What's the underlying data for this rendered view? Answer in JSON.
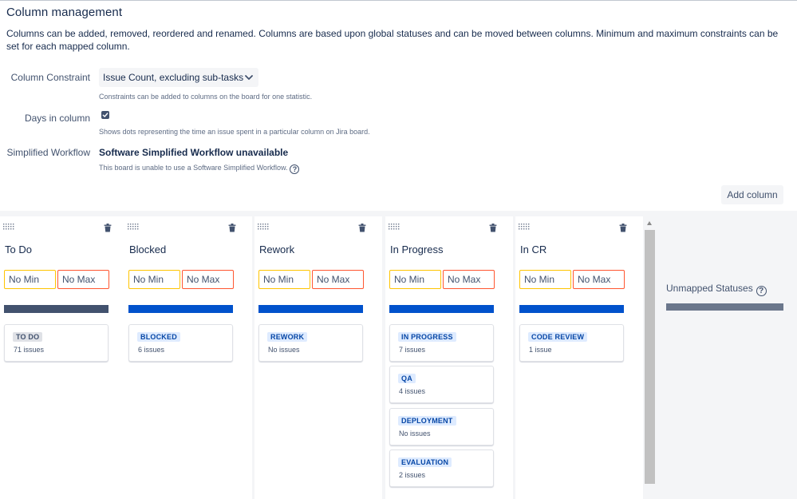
{
  "header": {
    "title": "Column management",
    "description": "Columns can be added, removed, reordered and renamed. Columns are based upon global statuses and can be moved between columns. Minimum and maximum constraints can be set for each mapped column."
  },
  "settings": {
    "constraint_label": "Column Constraint",
    "constraint_value": "Issue Count, excluding sub-tasks",
    "constraint_help": "Constraints can be added to columns on the board for one statistic.",
    "days_label": "Days in column",
    "days_checked": true,
    "days_help": "Shows dots representing the time an issue spent in a particular column on Jira board.",
    "workflow_label": "Simplified Workflow",
    "workflow_title": "Software Simplified Workflow unavailable",
    "workflow_help": "This board is unable to use a Software Simplified Workflow."
  },
  "actions": {
    "add_column": "Add column"
  },
  "colors": {
    "todo_bar": "#42526e",
    "progress_bar": "#0052cc",
    "unmapped_bar": "#6b778c",
    "todo_lozenge_bg": "#dfe1e6",
    "todo_lozenge_fg": "#42526e",
    "progress_lozenge_bg": "#deebff",
    "progress_lozenge_fg": "#0747a6"
  },
  "columns": [
    {
      "name": "To Do",
      "min_placeholder": "No Min",
      "max_placeholder": "No Max",
      "category": "todo",
      "statuses": [
        {
          "name": "TO DO",
          "count": "71 issues"
        }
      ]
    },
    {
      "name": "Blocked",
      "min_placeholder": "No Min",
      "max_placeholder": "No Max",
      "category": "progress",
      "statuses": [
        {
          "name": "BLOCKED",
          "count": "6 issues"
        }
      ]
    },
    {
      "name": "Rework",
      "min_placeholder": "No Min",
      "max_placeholder": "No Max",
      "category": "progress",
      "statuses": [
        {
          "name": "REWORK",
          "count": "No issues"
        }
      ]
    },
    {
      "name": "In Progress",
      "min_placeholder": "No Min",
      "max_placeholder": "No Max",
      "category": "progress",
      "statuses": [
        {
          "name": "IN PROGRESS",
          "count": "7 issues"
        },
        {
          "name": "QA",
          "count": "4 issues"
        },
        {
          "name": "DEPLOYMENT",
          "count": "No issues"
        },
        {
          "name": "EVALUATION",
          "count": "2 issues"
        }
      ]
    },
    {
      "name": "In CR",
      "min_placeholder": "No Min",
      "max_placeholder": "No Max",
      "category": "progress",
      "statuses": [
        {
          "name": "CODE REVIEW",
          "count": "1 issue"
        }
      ]
    }
  ],
  "unmapped": {
    "title": "Unmapped Statuses"
  }
}
